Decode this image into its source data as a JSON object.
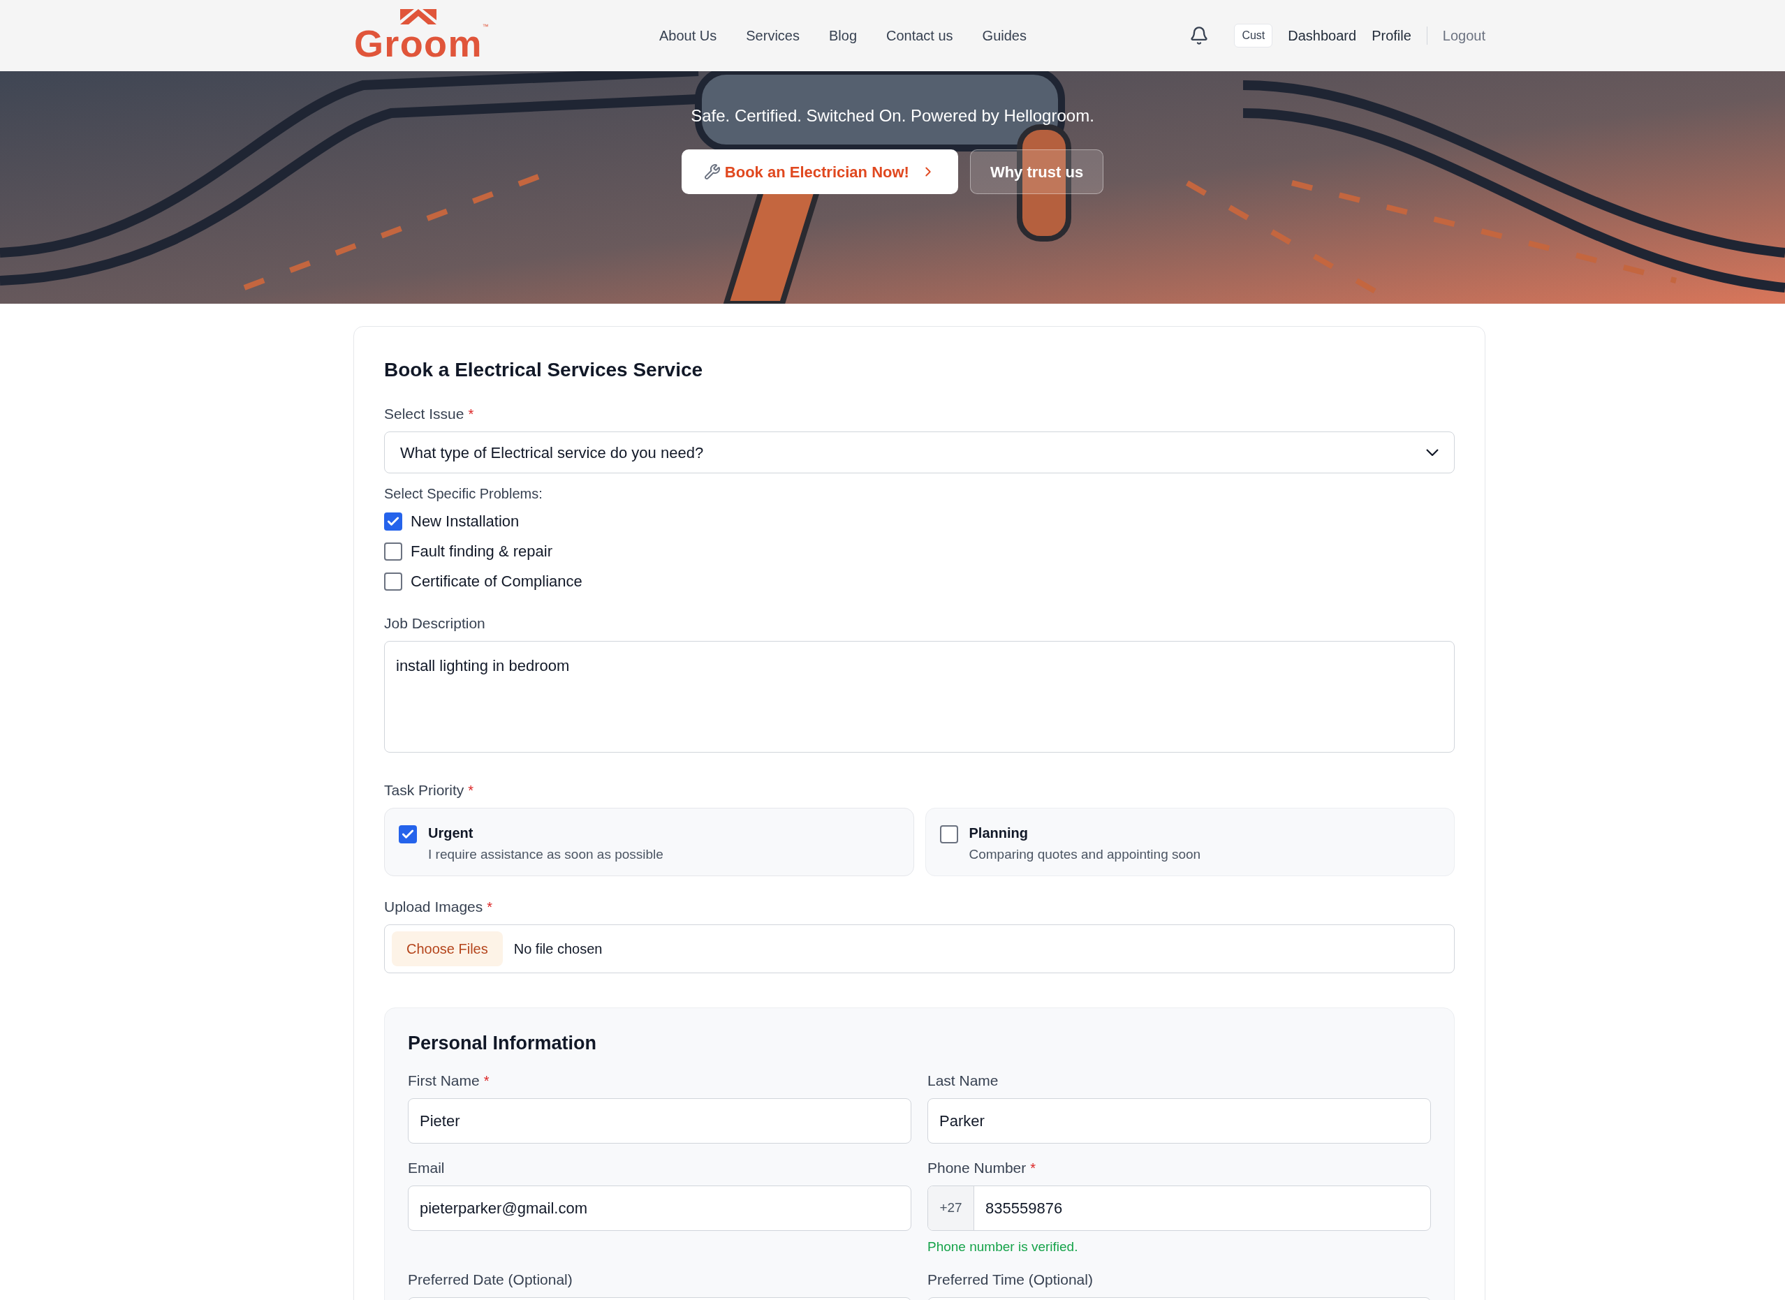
{
  "header": {
    "logo": {
      "text": "Groom",
      "mark": "™"
    },
    "nav": [
      "About Us",
      "Services",
      "Blog",
      "Contact us",
      "Guides"
    ],
    "user_badge": "Cust",
    "links": [
      "Dashboard",
      "Profile"
    ],
    "logout": "Logout"
  },
  "hero": {
    "subtitle": "Safe. Certified. Switched On. Powered by Hellogroom.",
    "buttons": [
      {
        "label": "Book an Electrician Now!",
        "kind": "primary"
      },
      {
        "label": "Why trust us",
        "kind": "secondary"
      }
    ]
  },
  "form": {
    "title": "Book a Electrical Services Service",
    "required_mark": "*",
    "issue": {
      "label": "Select Issue",
      "required": true,
      "value": "What type of Electrical service do you need?"
    },
    "problems": {
      "label": "Select Specific Problems:",
      "options": [
        {
          "label": "New Installation",
          "checked": true
        },
        {
          "label": "Fault finding & repair",
          "checked": false
        },
        {
          "label": "Certificate of Compliance",
          "checked": false
        }
      ]
    },
    "job_description": {
      "label": "Job Description",
      "required": false,
      "value": "install lighting in bedroom"
    },
    "priority": {
      "label": "Task Priority",
      "required": true,
      "options": [
        {
          "title": "Urgent",
          "description": "I require assistance as soon as possible",
          "selected": true
        },
        {
          "title": "Planning",
          "description": "Comparing quotes and appointing soon",
          "selected": false
        }
      ]
    },
    "upload": {
      "label": "Upload Images",
      "required": true,
      "button": "Choose Files",
      "status": "No file chosen"
    },
    "personal": {
      "title": "Personal Information",
      "fields": [
        {
          "label": "First Name",
          "required": true,
          "kind": "text",
          "value": "Pieter"
        },
        {
          "label": "Last Name",
          "required": false,
          "kind": "text",
          "value": "Parker"
        },
        {
          "label": "Email",
          "required": false,
          "kind": "text",
          "value": "pieterparker@gmail.com"
        },
        {
          "label": "Phone Number",
          "required": true,
          "kind": "phone",
          "prefix": "+27",
          "value": "835559876",
          "note": "Phone number is verified."
        },
        {
          "label": "Preferred Date (Optional)",
          "required": false,
          "kind": "text"
        },
        {
          "label": "Preferred Time (Optional)",
          "required": false,
          "kind": "text"
        }
      ]
    }
  }
}
